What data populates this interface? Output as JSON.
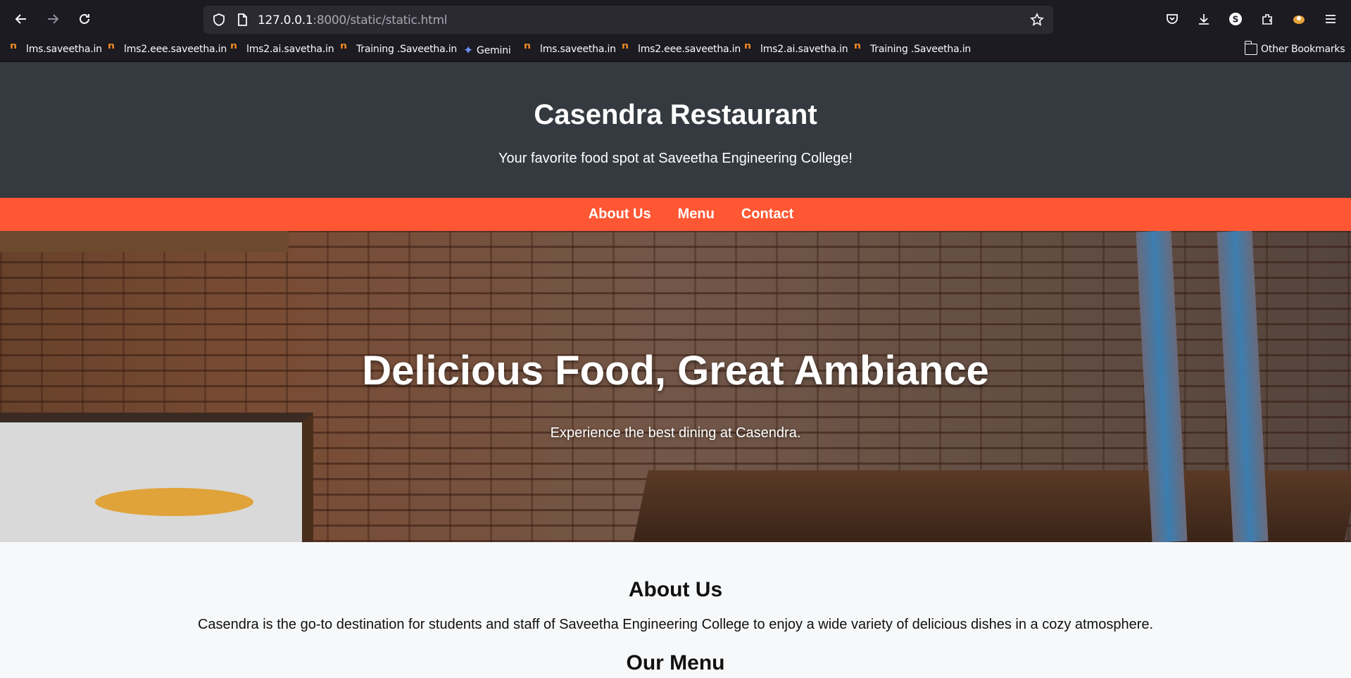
{
  "browser": {
    "url_host": "127.0.0.1",
    "url_path": ":8000/static/static.html",
    "bookmarks": [
      {
        "label": "lms.saveetha.in",
        "icon": "moodle-icon"
      },
      {
        "label": "lms2.eee.saveetha.in",
        "icon": "moodle-icon"
      },
      {
        "label": "lms2.ai.savetha.in",
        "icon": "moodle-icon"
      },
      {
        "label": "Training .Saveetha.in",
        "icon": "moodle-icon"
      },
      {
        "label": "Gemini",
        "icon": "gemini-icon"
      },
      {
        "label": "lms.saveetha.in",
        "icon": "moodle-icon"
      },
      {
        "label": "lms2.eee.saveetha.in",
        "icon": "moodle-icon"
      },
      {
        "label": "lms2.ai.savetha.in",
        "icon": "moodle-icon"
      },
      {
        "label": "Training .Saveetha.in",
        "icon": "moodle-icon"
      }
    ],
    "other_bookmarks": "Other Bookmarks",
    "profile_initial": "S"
  },
  "site": {
    "title": "Casendra Restaurant",
    "tagline": "Your favorite food spot at Saveetha Engineering College!",
    "nav": [
      "About Us",
      "Menu",
      "Contact"
    ],
    "accent_color": "#ff5733",
    "header_color": "#343a40"
  },
  "hero": {
    "title": "Delicious Food, Great Ambiance",
    "subtitle": "Experience the best dining at Casendra."
  },
  "about": {
    "heading": "About Us",
    "text": "Casendra is the go-to destination for students and staff of Saveetha Engineering College to enjoy a wide variety of delicious dishes in a cozy atmosphere."
  },
  "menu": {
    "heading": "Our Menu"
  }
}
